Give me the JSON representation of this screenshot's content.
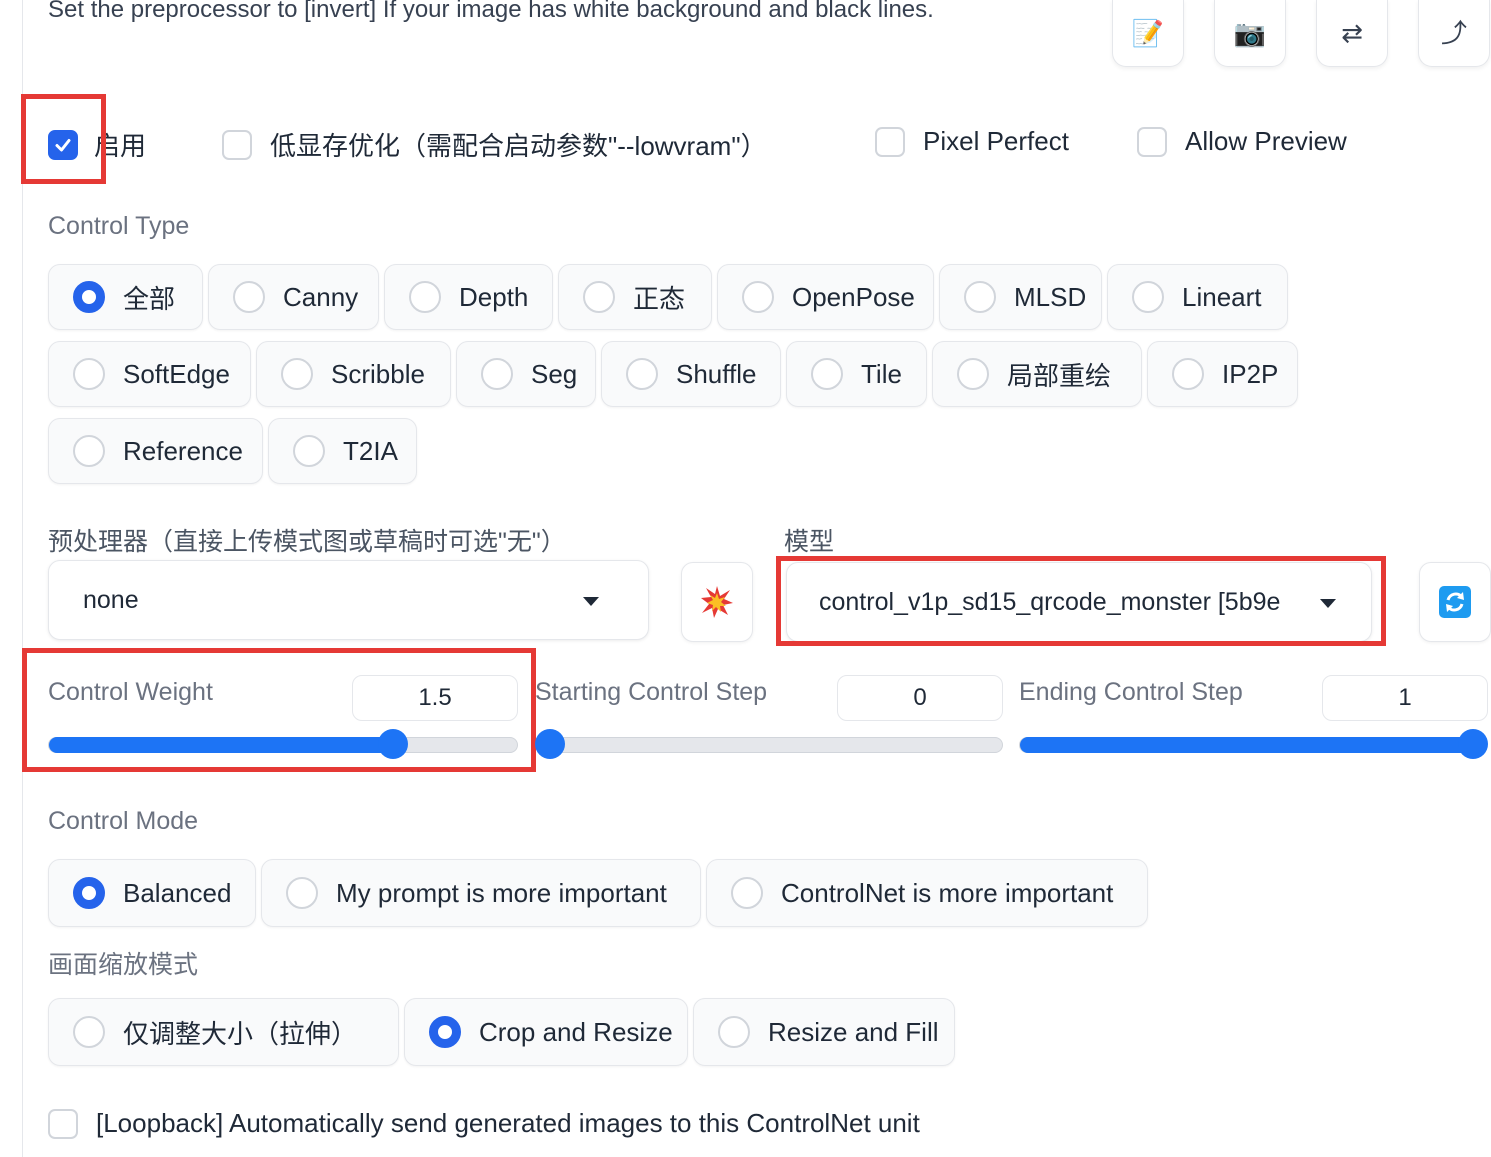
{
  "note": "Set the preprocessor to [invert] If your image has white background and black lines.",
  "toolbar": {
    "icons": [
      "edit-icon",
      "camera-icon",
      "swap-icon",
      "send-up-icon"
    ],
    "glyphs": [
      "📝",
      "📷",
      "⇄",
      "⤴"
    ]
  },
  "checkboxes": {
    "enable": {
      "label": "启用",
      "checked": true
    },
    "lowvram": {
      "label": "低显存优化（需配合启动参数\"--lowvram\"）",
      "checked": false
    },
    "pixel_perfect": {
      "label": "Pixel Perfect",
      "checked": false
    },
    "allow_preview": {
      "label": "Allow Preview",
      "checked": false
    }
  },
  "control_type": {
    "label": "Control Type",
    "selected": "全部",
    "options": [
      "全部",
      "Canny",
      "Depth",
      "正态",
      "OpenPose",
      "MLSD",
      "Lineart",
      "SoftEdge",
      "Scribble",
      "Seg",
      "Shuffle",
      "Tile",
      "局部重绘",
      "IP2P",
      "Reference",
      "T2IA"
    ]
  },
  "preprocessor": {
    "label": "预处理器（直接上传模式图或草稿时可选\"无\"）",
    "value": "none"
  },
  "model": {
    "label": "模型",
    "value": "control_v1p_sd15_qrcode_monster [5b9e"
  },
  "sliders": {
    "weight": {
      "label": "Control Weight",
      "value": "1.5",
      "fraction": 0.735
    },
    "start": {
      "label": "Starting Control Step",
      "value": "0",
      "fraction": 0.0
    },
    "end": {
      "label": "Ending Control Step",
      "value": "1",
      "fraction": 1.0
    }
  },
  "control_mode": {
    "label": "Control Mode",
    "selected": "Balanced",
    "options": [
      "Balanced",
      "My prompt is more important",
      "ControlNet is more important"
    ]
  },
  "resize_mode": {
    "label": "画面缩放模式",
    "selected": "Crop and Resize",
    "options": [
      "仅调整大小（拉伸）",
      "Crop and Resize",
      "Resize and Fill"
    ]
  },
  "loopback": {
    "label": "[Loopback] Automatically send generated images to this ControlNet unit",
    "checked": false
  },
  "colors": {
    "accent": "#2563eb",
    "highlight": "#e53935",
    "slider": "#1d74f5"
  }
}
